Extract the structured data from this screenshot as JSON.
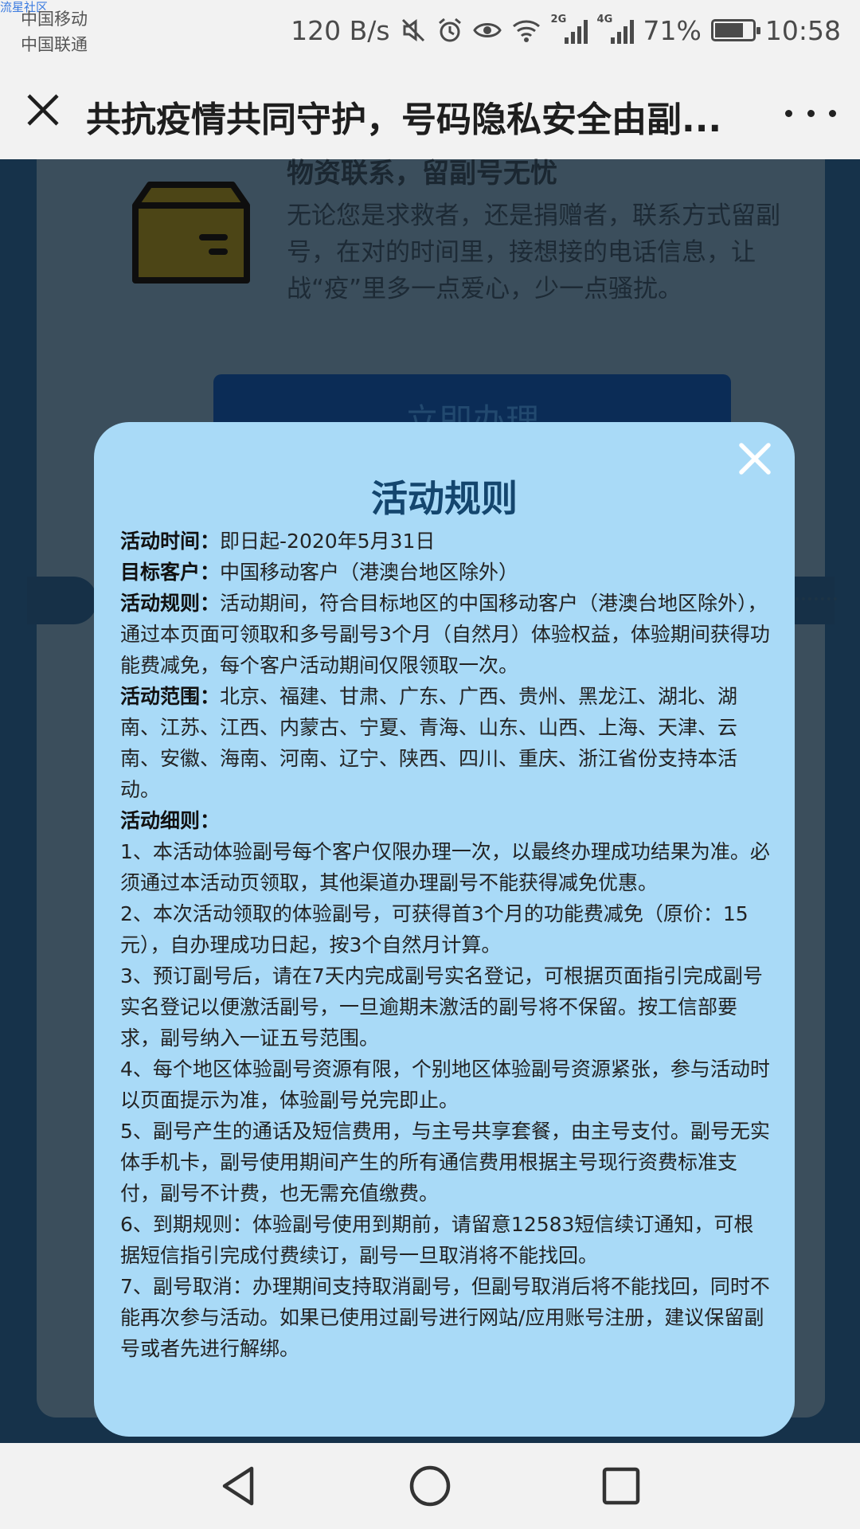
{
  "status_bar": {
    "watermark": "流星社区",
    "carrier_1": "中国移动",
    "carrier_2": "中国联通",
    "net_speed": "120 B/s",
    "sig1_tag": "2G",
    "sig2_tag": "4G",
    "battery_percent": "71%",
    "battery_level": 0.71,
    "time": "10:58"
  },
  "title_bar": {
    "title": "共抗疫情共同守护，号码隐私安全由副..."
  },
  "background_page": {
    "heading": "物资联系，留副号无忧",
    "text": "无论您是求救者，还是捐赠者，联系方式留副号，在对的时间里，接想接的电话信息，让战“疫”里多一点爱心，少一点骚扰。",
    "button_label": "立即办理"
  },
  "modal": {
    "title": "活动规则",
    "items": [
      {
        "label": "活动时间：",
        "text": "即日起-2020年5月31日"
      },
      {
        "label": "目标客户：",
        "text": "中国移动客户（港澳台地区除外）"
      },
      {
        "label": "活动规则：",
        "text": "活动期间，符合目标地区的中国移动客户（港澳台地区除外），通过本页面可领取和多号副号3个月（自然月）体验权益，体验期间获得功能费减免，每个客户活动期间仅限领取一次。"
      },
      {
        "label": "活动范围：",
        "text": "北京、福建、甘肃、广东、广西、贵州、黑龙江、湖北、湖南、江苏、江西、内蒙古、宁夏、青海、山东、山西、上海、天津、云南、安徽、海南、河南、辽宁、陕西、四川、重庆、浙江省份支持本活动。"
      },
      {
        "label": "活动细则：",
        "text": ""
      }
    ],
    "rules": [
      "1、本活动体验副号每个客户仅限办理一次，以最终办理成功结果为准。必须通过本活动页领取，其他渠道办理副号不能获得减免优惠。",
      "2、本次活动领取的体验副号，可获得首3个月的功能费减免（原价：15元），自办理成功日起，按3个自然月计算。",
      "3、预订副号后，请在7天内完成副号实名登记，可根据页面指引完成副号实名登记以便激活副号，一旦逾期未激活的副号将不保留。按工信部要求，副号纳入一证五号范围。",
      "4、每个地区体验副号资源有限，个别地区体验副号资源紧张，参与活动时以页面提示为准，体验副号兑完即止。",
      "5、副号产生的通话及短信费用，与主号共享套餐，由主号支付。副号无实体手机卡，副号使用期间产生的所有通信费用根据主号现行资费标准支付，副号不计费，也无需充值缴费。",
      "6、到期规则：体验副号使用到期前，请留意12583短信续订通知，可根据短信指引完成付费续订，副号一旦取消将不能找回。",
      "7、副号取消：办理期间支持取消副号，但副号取消后将不能找回，同时不能再次参与活动。如果已使用过副号进行网站/应用账号注册，建议保留副号或者先进行解绑。"
    ]
  },
  "colors": {
    "modal_bg": "#a9daf7",
    "modal_title": "#14466e",
    "page_bg": "#16324a",
    "bar_bg": "#f2f2f2"
  }
}
